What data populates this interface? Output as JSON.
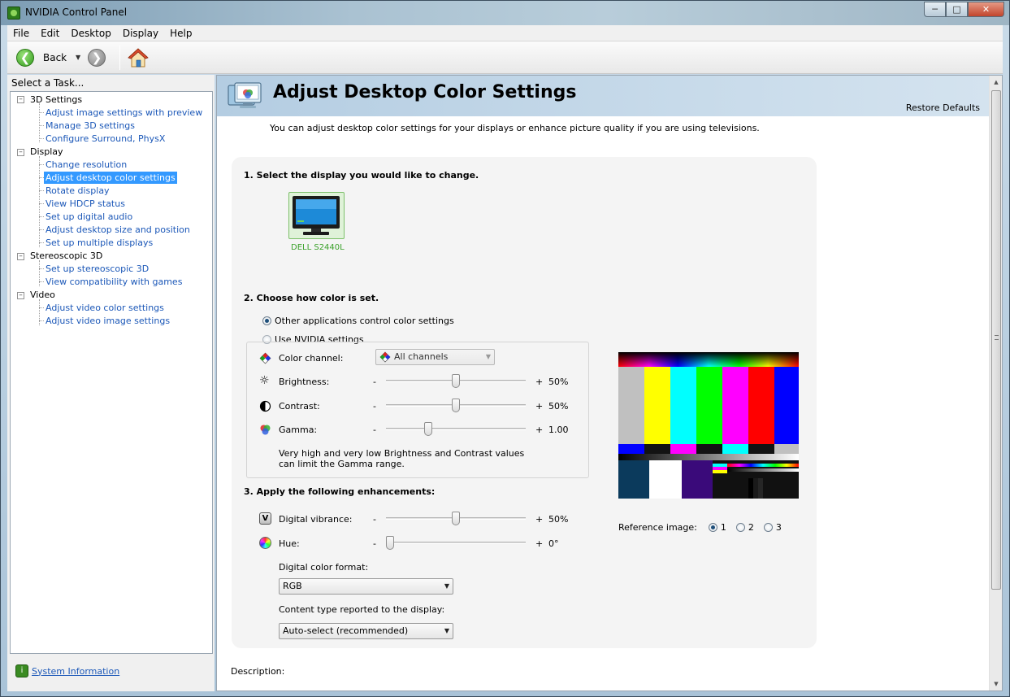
{
  "window": {
    "title": "NVIDIA Control Panel",
    "controls": [
      "minimize",
      "maximize",
      "close"
    ]
  },
  "menu": [
    "File",
    "Edit",
    "Desktop",
    "Display",
    "Help"
  ],
  "toolbar": {
    "back_label": "Back"
  },
  "sidebar": {
    "title": "Select a Task...",
    "categories": [
      {
        "label": "3D Settings",
        "items": [
          "Adjust image settings with preview",
          "Manage 3D settings",
          "Configure Surround, PhysX"
        ]
      },
      {
        "label": "Display",
        "items": [
          "Change resolution",
          "Adjust desktop color settings",
          "Rotate display",
          "View HDCP status",
          "Set up digital audio",
          "Adjust desktop size and position",
          "Set up multiple displays"
        ]
      },
      {
        "label": "Stereoscopic 3D",
        "items": [
          "Set up stereoscopic 3D",
          "View compatibility with games"
        ]
      },
      {
        "label": "Video",
        "items": [
          "Adjust video color settings",
          "Adjust video image settings"
        ]
      }
    ],
    "selected_item": "Adjust desktop color settings",
    "system_info": "System Information"
  },
  "page": {
    "title": "Adjust Desktop Color Settings",
    "restore_defaults": "Restore Defaults",
    "intro": "You can adjust desktop color settings for your displays or enhance picture quality if you are using televisions.",
    "step1": "1. Select the display you would like to change.",
    "display_name": "DELL S2440L",
    "step2": "2. Choose how color is set.",
    "radio_other": "Other applications control color settings",
    "radio_nvidia": "Use NVIDIA settings",
    "color_channel_label": "Color channel:",
    "color_channel_value": "All channels",
    "brightness_label": "Brightness:",
    "brightness_value": "50%",
    "contrast_label": "Contrast:",
    "contrast_value": "50%",
    "gamma_label": "Gamma:",
    "gamma_value": "1.00",
    "minus": "-",
    "plus": "+",
    "note": "Very high and very low Brightness and Contrast values can limit the Gamma range.",
    "step3": "3. Apply the following enhancements:",
    "vibrance_label": "Digital vibrance:",
    "vibrance_value": "50%",
    "hue_label": "Hue:",
    "hue_value": "0°",
    "color_format_label": "Digital color format:",
    "color_format_value": "RGB",
    "content_type_label": "Content type reported to the display:",
    "content_type_value": "Auto-select (recommended)",
    "reference_label": "Reference image:",
    "reference_options": [
      "1",
      "2",
      "3"
    ],
    "description_label": "Description:"
  },
  "slider_levels": {
    "brightness": 0.5,
    "contrast": 0.5,
    "gamma": 0.29,
    "vibrance": 0.5,
    "hue": 0.0
  },
  "colors": {
    "link": "#1c58b8",
    "selection": "#3399ff",
    "display_label": "#3aa12a"
  }
}
